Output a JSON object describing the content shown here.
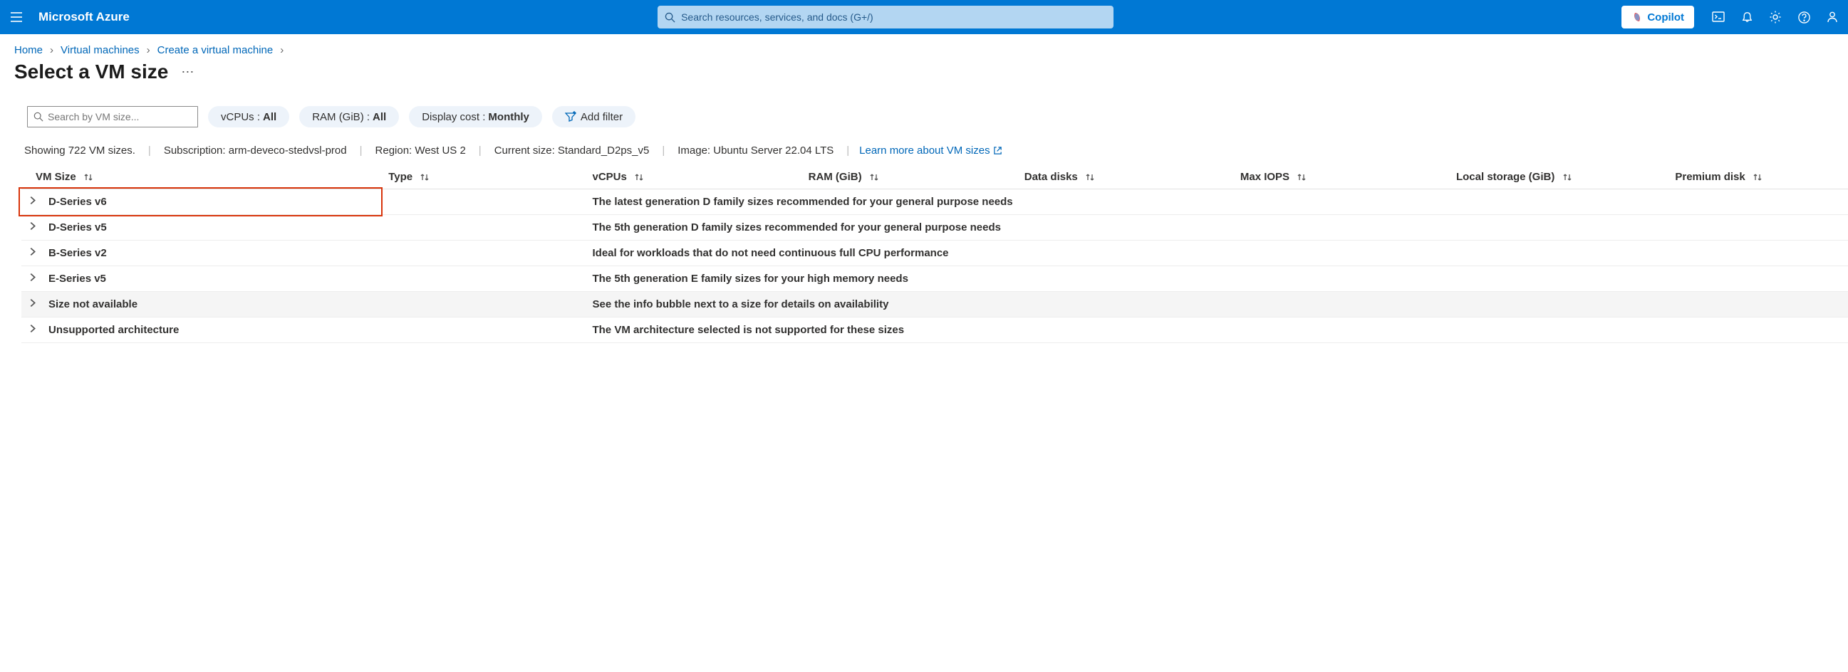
{
  "header": {
    "brand": "Microsoft Azure",
    "search_placeholder": "Search resources, services, and docs (G+/)",
    "copilot_label": "Copilot"
  },
  "breadcrumb": {
    "items": [
      "Home",
      "Virtual machines",
      "Create a virtual machine"
    ]
  },
  "page": {
    "title": "Select a VM size"
  },
  "filters": {
    "search_placeholder": "Search by VM size...",
    "vcpu_label": "vCPUs :",
    "vcpu_value": "All",
    "ram_label": "RAM (GiB) :",
    "ram_value": "All",
    "cost_label": "Display cost :",
    "cost_value": "Monthly",
    "add_filter": "Add filter"
  },
  "status": {
    "showing": "Showing 722 VM sizes.",
    "subscription": "Subscription: arm-deveco-stedvsl-prod",
    "region": "Region: West US 2",
    "current_size": "Current size: Standard_D2ps_v5",
    "image": "Image: Ubuntu Server 22.04 LTS",
    "learn_more": "Learn more about VM sizes"
  },
  "table": {
    "headers": {
      "vm_size": "VM Size",
      "type": "Type",
      "vcpus": "vCPUs",
      "ram": "RAM (GiB)",
      "disks": "Data disks",
      "iops": "Max IOPS",
      "local": "Local storage (GiB)",
      "premium": "Premium disk"
    },
    "rows": [
      {
        "name": "D-Series v6",
        "desc": "The latest generation D family sizes recommended for your general purpose needs",
        "highlight": true
      },
      {
        "name": "D-Series v5",
        "desc": "The 5th generation D family sizes recommended for your general purpose needs"
      },
      {
        "name": "B-Series v2",
        "desc": "Ideal for workloads that do not need continuous full CPU performance"
      },
      {
        "name": "E-Series v5",
        "desc": "The 5th generation E family sizes for your high memory needs"
      },
      {
        "name": "Size not available",
        "desc": "See the info bubble next to a size for details on availability",
        "greyed": true
      },
      {
        "name": "Unsupported architecture",
        "desc": "The VM architecture selected is not supported for these sizes"
      }
    ]
  }
}
